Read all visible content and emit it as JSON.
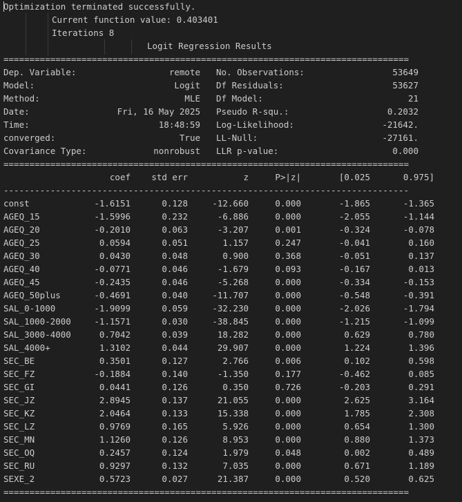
{
  "header": {
    "status": "Optimization terminated successfully.",
    "function_value": "Current function value: 0.403401",
    "iterations": "Iterations 8",
    "title": "Logit Regression Results"
  },
  "rules": {
    "double": "==============================================================================",
    "single": "------------------------------------------------------------------------------"
  },
  "summary": [
    {
      "l_key": "Dep. Variable:",
      "l_val": "remote",
      "r_key": "No. Observations:",
      "r_val": "53649"
    },
    {
      "l_key": "Model:",
      "l_val": "Logit",
      "r_key": "Df Residuals:",
      "r_val": "53627"
    },
    {
      "l_key": "Method:",
      "l_val": "MLE",
      "r_key": "Df Model:",
      "r_val": "21"
    },
    {
      "l_key": "Date:",
      "l_val": "Fri, 16 May 2025",
      "r_key": "Pseudo R-squ.:",
      "r_val": "0.2032"
    },
    {
      "l_key": "Time:",
      "l_val": "18:48:59",
      "r_key": "Log-Likelihood:",
      "r_val": "-21642."
    },
    {
      "l_key": "converged:",
      "l_val": "True",
      "r_key": "LL-Null:",
      "r_val": "-27161."
    },
    {
      "l_key": "Covariance Type:",
      "l_val": "nonrobust",
      "r_key": "LLR p-value:",
      "r_val": "0.000"
    }
  ],
  "columns": [
    "coef",
    "std err",
    "z",
    "P>|z|",
    "[0.025",
    "0.975]"
  ],
  "rows": [
    {
      "name": "const",
      "coef": "-1.6151",
      "se": "0.128",
      "z": "-12.660",
      "p": "0.000",
      "lo": "-1.865",
      "hi": "-1.365"
    },
    {
      "name": "AGEQ_15",
      "coef": "-1.5996",
      "se": "0.232",
      "z": "-6.886",
      "p": "0.000",
      "lo": "-2.055",
      "hi": "-1.144"
    },
    {
      "name": "AGEQ_20",
      "coef": "-0.2010",
      "se": "0.063",
      "z": "-3.207",
      "p": "0.001",
      "lo": "-0.324",
      "hi": "-0.078"
    },
    {
      "name": "AGEQ_25",
      "coef": "0.0594",
      "se": "0.051",
      "z": "1.157",
      "p": "0.247",
      "lo": "-0.041",
      "hi": "0.160"
    },
    {
      "name": "AGEQ_30",
      "coef": "0.0430",
      "se": "0.048",
      "z": "0.900",
      "p": "0.368",
      "lo": "-0.051",
      "hi": "0.137"
    },
    {
      "name": "AGEQ_40",
      "coef": "-0.0771",
      "se": "0.046",
      "z": "-1.679",
      "p": "0.093",
      "lo": "-0.167",
      "hi": "0.013"
    },
    {
      "name": "AGEQ_45",
      "coef": "-0.2435",
      "se": "0.046",
      "z": "-5.268",
      "p": "0.000",
      "lo": "-0.334",
      "hi": "-0.153"
    },
    {
      "name": "AGEQ_50plus",
      "coef": "-0.4691",
      "se": "0.040",
      "z": "-11.707",
      "p": "0.000",
      "lo": "-0.548",
      "hi": "-0.391"
    },
    {
      "name": "SAL_0-1000",
      "coef": "-1.9099",
      "se": "0.059",
      "z": "-32.230",
      "p": "0.000",
      "lo": "-2.026",
      "hi": "-1.794"
    },
    {
      "name": "SAL_1000-2000",
      "coef": "-1.1571",
      "se": "0.030",
      "z": "-38.845",
      "p": "0.000",
      "lo": "-1.215",
      "hi": "-1.099"
    },
    {
      "name": "SAL_3000-4000",
      "coef": "0.7042",
      "se": "0.039",
      "z": "18.282",
      "p": "0.000",
      "lo": "0.629",
      "hi": "0.780"
    },
    {
      "name": "SAL_4000+",
      "coef": "1.3102",
      "se": "0.044",
      "z": "29.907",
      "p": "0.000",
      "lo": "1.224",
      "hi": "1.396"
    },
    {
      "name": "SEC_BE",
      "coef": "0.3501",
      "se": "0.127",
      "z": "2.766",
      "p": "0.006",
      "lo": "0.102",
      "hi": "0.598"
    },
    {
      "name": "SEC_FZ",
      "coef": "-0.1884",
      "se": "0.140",
      "z": "-1.350",
      "p": "0.177",
      "lo": "-0.462",
      "hi": "0.085"
    },
    {
      "name": "SEC_GI",
      "coef": "0.0441",
      "se": "0.126",
      "z": "0.350",
      "p": "0.726",
      "lo": "-0.203",
      "hi": "0.291"
    },
    {
      "name": "SEC_JZ",
      "coef": "2.8945",
      "se": "0.137",
      "z": "21.055",
      "p": "0.000",
      "lo": "2.625",
      "hi": "3.164"
    },
    {
      "name": "SEC_KZ",
      "coef": "2.0464",
      "se": "0.133",
      "z": "15.338",
      "p": "0.000",
      "lo": "1.785",
      "hi": "2.308"
    },
    {
      "name": "SEC_LZ",
      "coef": "0.9769",
      "se": "0.165",
      "z": "5.926",
      "p": "0.000",
      "lo": "0.654",
      "hi": "1.300"
    },
    {
      "name": "SEC_MN",
      "coef": "1.1260",
      "se": "0.126",
      "z": "8.953",
      "p": "0.000",
      "lo": "0.880",
      "hi": "1.373"
    },
    {
      "name": "SEC_OQ",
      "coef": "0.2457",
      "se": "0.124",
      "z": "1.979",
      "p": "0.048",
      "lo": "0.002",
      "hi": "0.489"
    },
    {
      "name": "SEC_RU",
      "coef": "0.9297",
      "se": "0.132",
      "z": "7.035",
      "p": "0.000",
      "lo": "0.671",
      "hi": "1.189"
    },
    {
      "name": "SEXE_2",
      "coef": "0.5723",
      "se": "0.027",
      "z": "21.387",
      "p": "0.000",
      "lo": "0.520",
      "hi": "0.625"
    }
  ]
}
